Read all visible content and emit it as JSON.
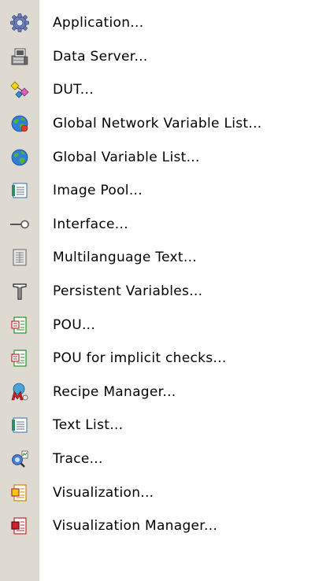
{
  "menu": {
    "items": [
      {
        "label": "Application...",
        "icon": "gear-icon"
      },
      {
        "label": "Data Server...",
        "icon": "data-server-icon"
      },
      {
        "label": "DUT...",
        "icon": "dut-icon"
      },
      {
        "label": "Global Network Variable List...",
        "icon": "globe-network-icon"
      },
      {
        "label": "Global Variable List...",
        "icon": "globe-icon"
      },
      {
        "label": "Image Pool...",
        "icon": "image-pool-icon"
      },
      {
        "label": "Interface...",
        "icon": "interface-icon"
      },
      {
        "label": "Multilanguage Text...",
        "icon": "multilanguage-text-icon"
      },
      {
        "label": "Persistent Variables...",
        "icon": "persistent-variables-icon"
      },
      {
        "label": "POU...",
        "icon": "pou-icon"
      },
      {
        "label": "POU for implicit checks...",
        "icon": "pou-checks-icon"
      },
      {
        "label": "Recipe Manager...",
        "icon": "recipe-manager-icon"
      },
      {
        "label": "Text List...",
        "icon": "text-list-icon"
      },
      {
        "label": "Trace...",
        "icon": "trace-icon"
      },
      {
        "label": "Visualization...",
        "icon": "visualization-icon"
      },
      {
        "label": "Visualization Manager...",
        "icon": "visualization-manager-icon"
      }
    ]
  }
}
